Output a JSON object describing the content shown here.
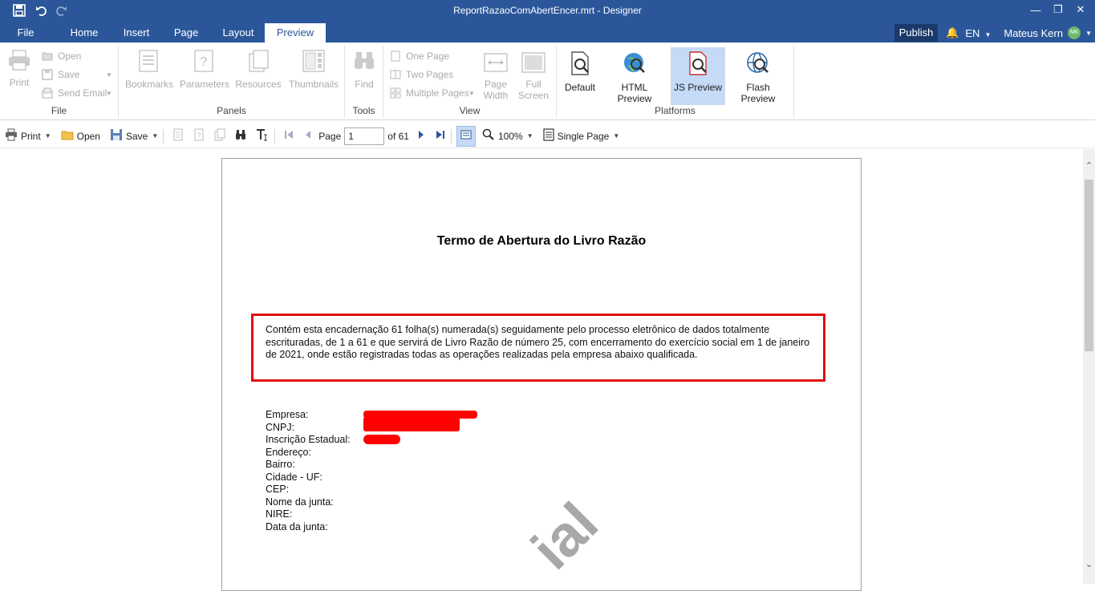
{
  "window": {
    "title": "ReportRazaoComAbertEncer.mrt - Designer"
  },
  "tabs": [
    {
      "label": "File"
    },
    {
      "label": "Home"
    },
    {
      "label": "Insert"
    },
    {
      "label": "Page"
    },
    {
      "label": "Layout"
    },
    {
      "label": "Preview"
    }
  ],
  "header_right": {
    "publish_label": "Publish",
    "language": "EN",
    "user_name": "Mateus Kern",
    "user_initials": "MK"
  },
  "ribbon": {
    "file_group": {
      "label": "File",
      "print": "Print",
      "open": "Open",
      "save": "Save",
      "send_email": "Send Email"
    },
    "panels_group": {
      "label": "Panels",
      "bookmarks": "Bookmarks",
      "parameters": "Parameters",
      "resources": "Resources",
      "thumbnails": "Thumbnails"
    },
    "tools_group": {
      "label": "Tools",
      "find": "Find"
    },
    "view_group": {
      "label": "View",
      "one_page": "One Page",
      "two_pages": "Two Pages",
      "multiple_pages": "Multiple Pages",
      "page_width_line1": "Page",
      "page_width_line2": "Width",
      "full_screen_line1": "Full",
      "full_screen_line2": "Screen"
    },
    "platforms_group": {
      "label": "Platforms",
      "default": "Default",
      "html_preview": "HTML Preview",
      "js_preview": "JS Preview",
      "flash_preview": "Flash Preview"
    }
  },
  "viewer_toolbar": {
    "print": "Print",
    "open": "Open",
    "save": "Save",
    "page_label": "Page",
    "page_value": "1",
    "page_of": "of 61",
    "zoom": "100%",
    "view_mode": "Single Page"
  },
  "document": {
    "title": "Termo de Abertura do Livro Razão",
    "paragraph": "Contém esta encadernação 61 folha(s) numerada(s) seguidamente pelo processo eletrônico de dados totalmente escrituradas, de 1 a 61 e que servirá de Livro Razão de número 25, com encerramento do exercício social em 1 de janeiro de 2021, onde estão registradas todas as operações realizadas pela empresa abaixo qualificada.",
    "fields": [
      {
        "label": "Empresa:"
      },
      {
        "label": "CNPJ:"
      },
      {
        "label": "Inscrição Estadual:"
      },
      {
        "label": "Endereço:"
      },
      {
        "label": "Bairro:"
      },
      {
        "label": "Cidade - UF:"
      },
      {
        "label": "CEP:"
      },
      {
        "label": "Nome da junta:"
      },
      {
        "label": "NIRE:"
      },
      {
        "label": "Data da junta:"
      }
    ],
    "watermark": "ial"
  },
  "colors": {
    "title_bar": "#2b579a",
    "highlight_border": "#e01010",
    "redaction": "#ff0000",
    "selected_button": "#c5daf6"
  }
}
